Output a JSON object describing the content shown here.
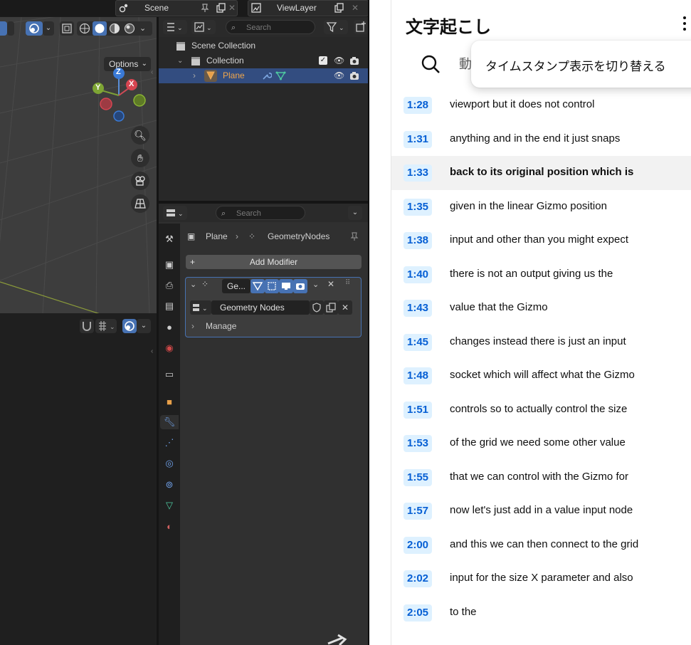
{
  "blender": {
    "scene_name": "Scene",
    "view_layer": "ViewLayer",
    "viewport": {
      "options_label": "Options",
      "gizmo_axes": [
        "Z",
        "Y",
        "X"
      ]
    },
    "outliner": {
      "search_placeholder": "Search",
      "rows": [
        {
          "label": "Scene Collection"
        },
        {
          "label": "Collection"
        },
        {
          "label": "Plane"
        }
      ]
    },
    "properties": {
      "search_placeholder": "Search",
      "breadcrumb_object": "Plane",
      "breadcrumb_modifier": "GeometryNodes",
      "add_modifier_label": "Add Modifier",
      "modifier_name": "Ge...",
      "node_group": "Geometry Nodes",
      "manage_label": "Manage"
    }
  },
  "transcript": {
    "title": "文字起こし",
    "search_partial": "動",
    "menu_item": "タイムスタンプ表示を切り替える",
    "highlighted_index": 2,
    "segments": [
      {
        "time": "1:28",
        "text": "viewport but it does not control"
      },
      {
        "time": "1:31",
        "text": "anything and in the end it just snaps"
      },
      {
        "time": "1:33",
        "text": "back to its original position which is"
      },
      {
        "time": "1:35",
        "text": "given in the linear Gizmo position"
      },
      {
        "time": "1:38",
        "text": "input and other than you might expect"
      },
      {
        "time": "1:40",
        "text": "there is not an output giving us the"
      },
      {
        "time": "1:43",
        "text": "value that the Gizmo"
      },
      {
        "time": "1:45",
        "text": "changes instead there is just an input"
      },
      {
        "time": "1:48",
        "text": "socket which will affect what the Gizmo"
      },
      {
        "time": "1:51",
        "text": "controls so to actually control the size"
      },
      {
        "time": "1:53",
        "text": "of the grid we need some other value"
      },
      {
        "time": "1:55",
        "text": "that we can control with the Gizmo for"
      },
      {
        "time": "1:57",
        "text": "now let's just add in a value input node"
      },
      {
        "time": "2:00",
        "text": "and this we can then connect to the grid"
      },
      {
        "time": "2:02",
        "text": "input for the size X parameter and also"
      },
      {
        "time": "2:05",
        "text": "to the"
      }
    ]
  }
}
